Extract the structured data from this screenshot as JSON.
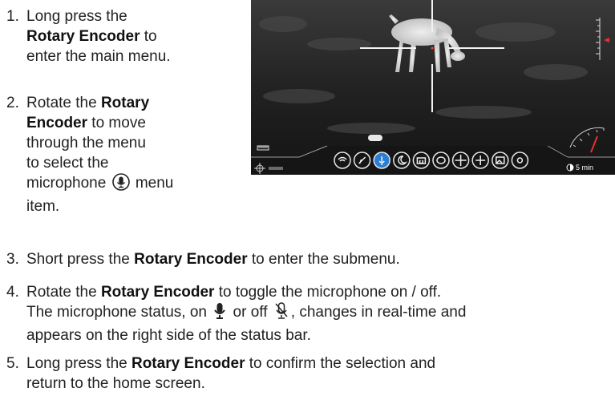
{
  "steps": [
    {
      "num": "1.",
      "lines": [
        {
          "t": "Long press the"
        },
        {
          "b": "Rotary Encoder",
          "t2": " to"
        },
        {
          "t": "enter the main menu."
        }
      ]
    },
    {
      "num": "2.",
      "parts": {
        "l1a": "Rotate the ",
        "l1b": "Rotary",
        "l2a": "Encoder",
        "l2b": " to move",
        "l3": "through the menu",
        "l4": "to select the",
        "l5a": "microphone",
        "l5b": "menu",
        "l6": "item."
      }
    },
    {
      "num": "3.",
      "a": "Short press the ",
      "b": "Rotary Encoder",
      "c": " to enter the submenu."
    },
    {
      "num": "4.",
      "a": "Rotate the ",
      "b": "Rotary Encoder",
      "c": " to toggle the microphone on / off.",
      "l2a": "The microphone status, on",
      "l2b": "or off",
      "l2c": ", changes in real-time and",
      "l3": "appears on the right side of the status bar."
    },
    {
      "num": "5.",
      "a": "Long press the ",
      "b": "Rotary Encoder",
      "c": " to confirm the selection and",
      "l2": "return to the home screen."
    }
  ],
  "screen": {
    "timer_label": "5 min",
    "icons": [
      "wifi-icon",
      "compass-icon",
      "microphone-icon",
      "night-mode-icon",
      "camera-icon",
      "palette-icon",
      "zeroing-icon",
      "reticle-icon",
      "gallery-icon",
      "settings-icon"
    ],
    "colors": {
      "highlight": "#2a7fd4",
      "needle": "#e8312f",
      "background": "#1d1d1d"
    }
  }
}
